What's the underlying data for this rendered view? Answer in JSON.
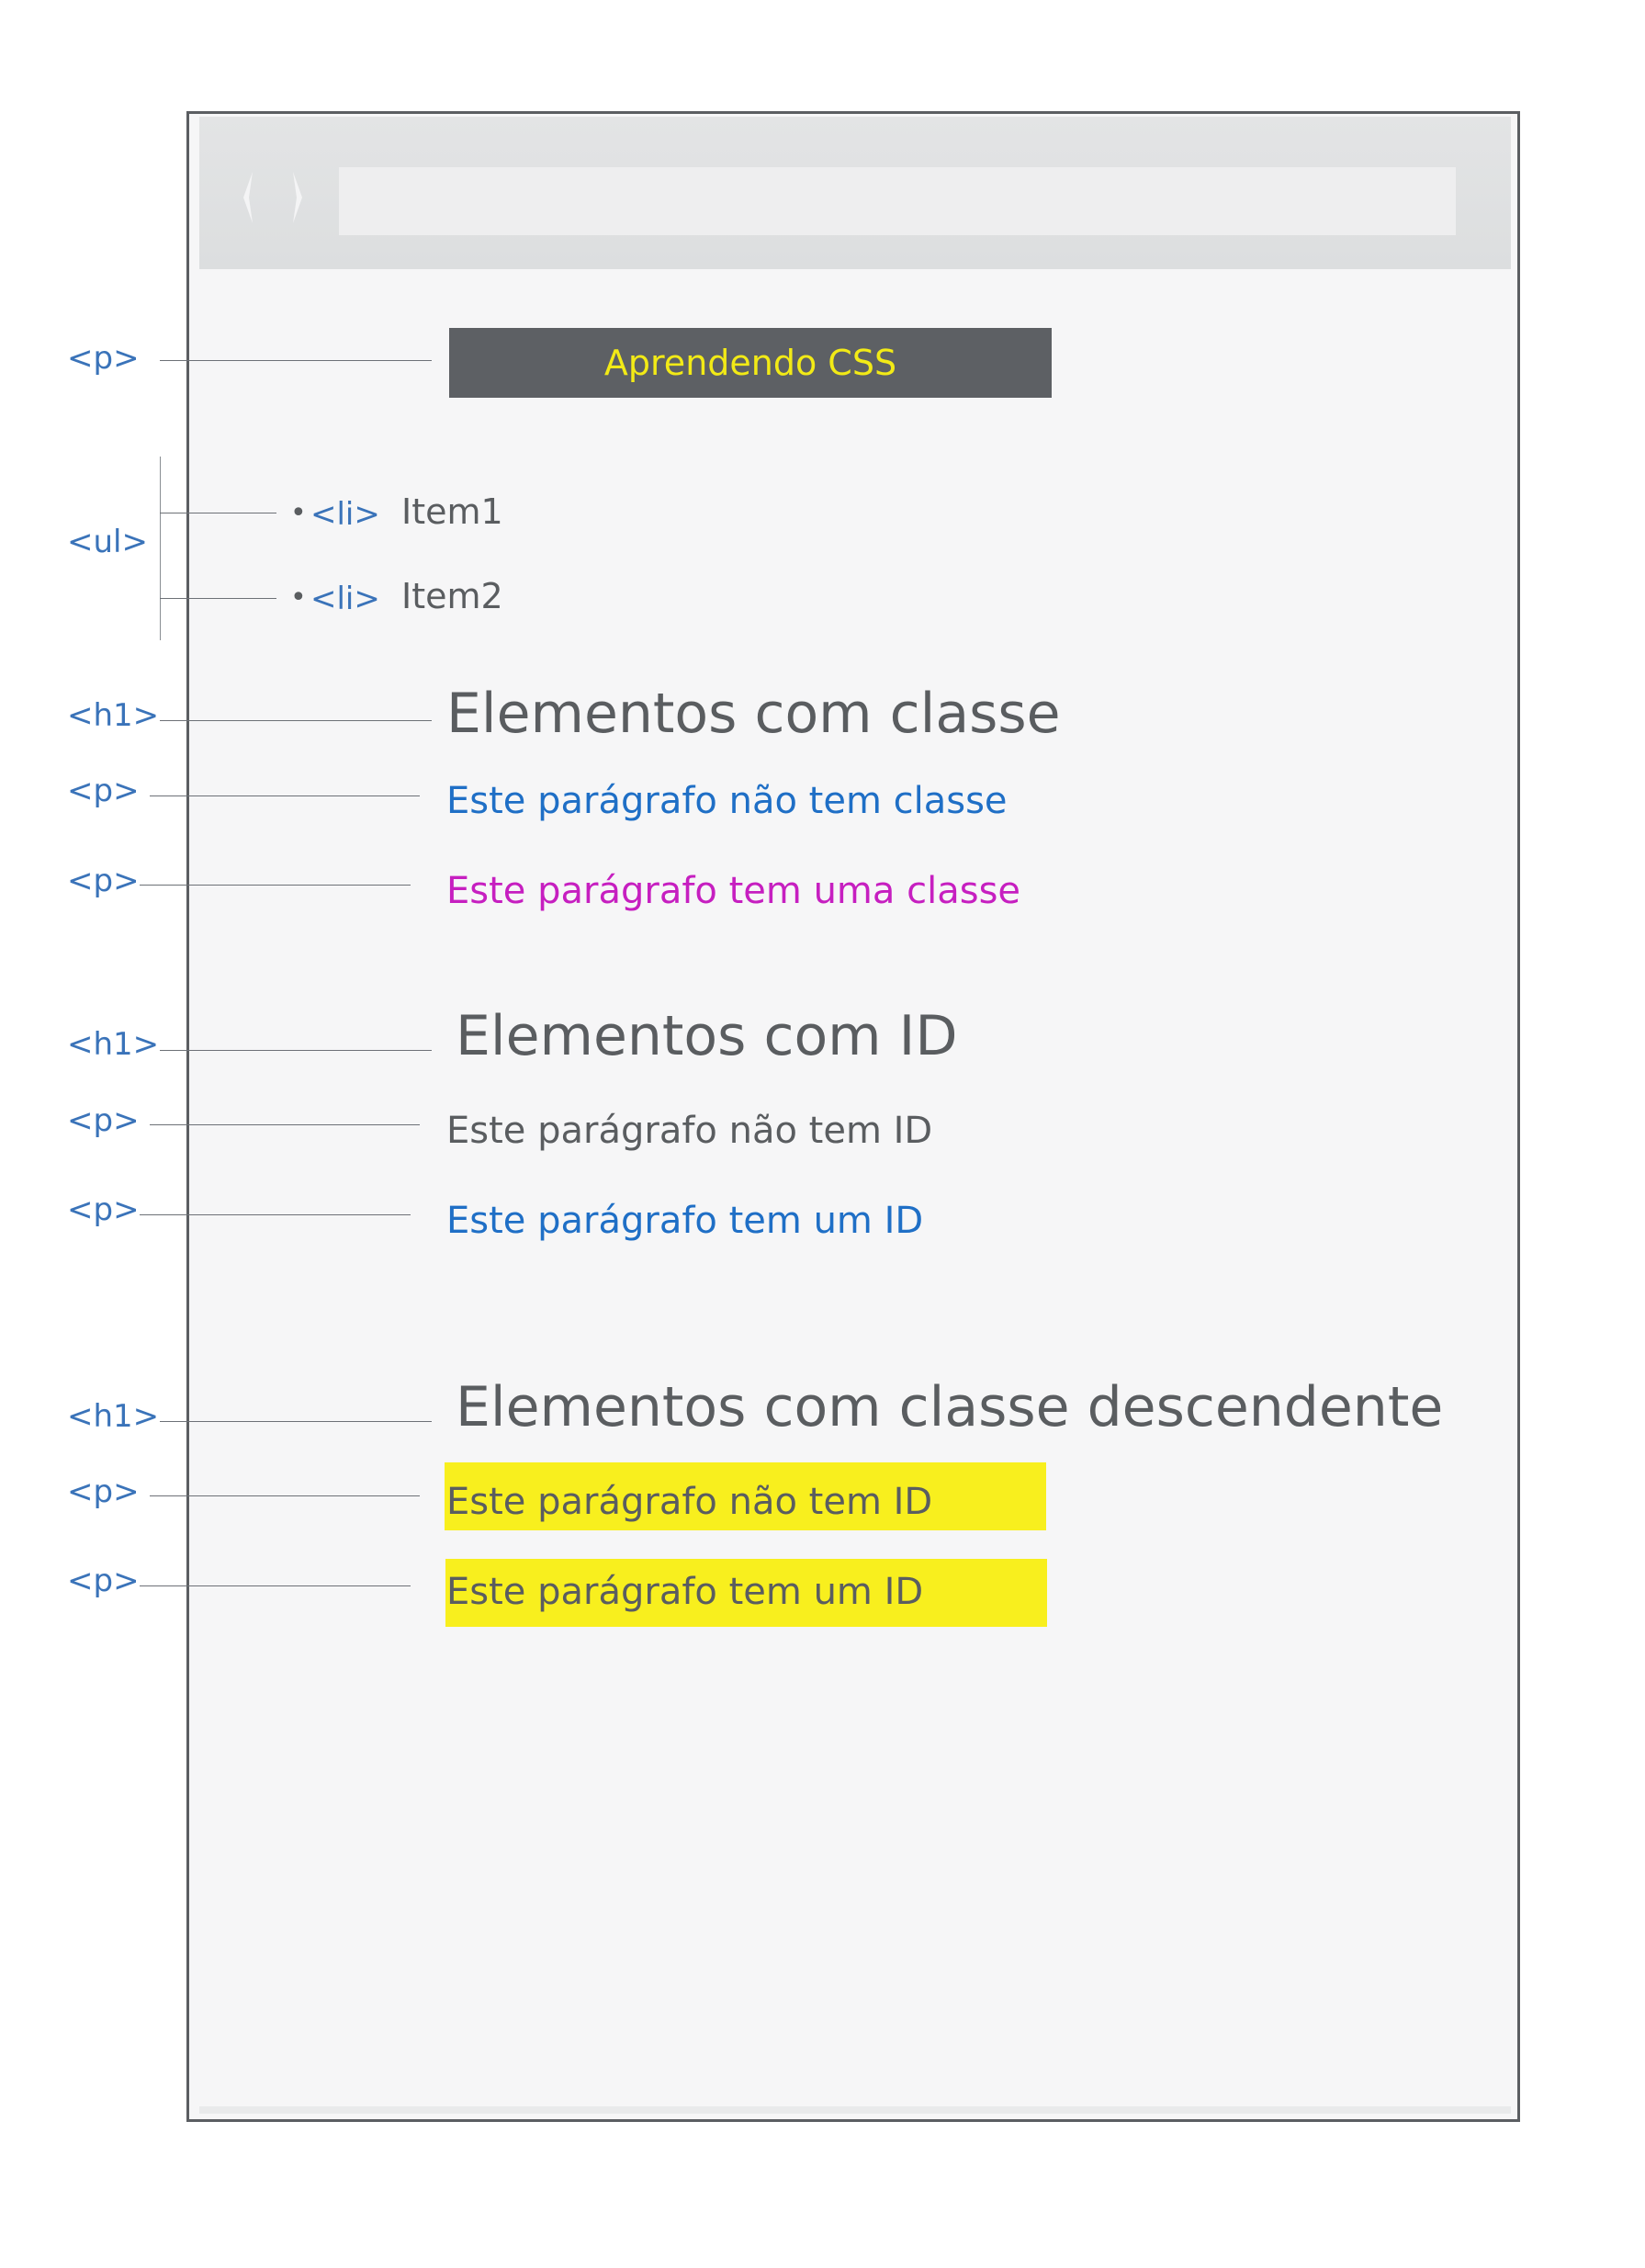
{
  "title_paragraph": {
    "text": "Aprendendo CSS",
    "bg_color": "#5d6064",
    "text_color": "#f2ea16"
  },
  "tags": {
    "p": "<p>",
    "ul": "<ul>",
    "li": "<li>",
    "h1": "<h1>"
  },
  "list": {
    "items": [
      "Item1",
      "Item2"
    ]
  },
  "sections": [
    {
      "heading": "Elementos com classe",
      "paragraphs": [
        {
          "text": "Este parágrafo não tem classe",
          "color": "#1f6fc6"
        },
        {
          "text": "Este parágrafo tem uma classe",
          "color": "#c61fc0"
        }
      ]
    },
    {
      "heading": "Elementos com ID",
      "paragraphs": [
        {
          "text": "Este parágrafo não tem ID",
          "color": "#5a5d60"
        },
        {
          "text": "Este parágrafo tem um ID",
          "color": "#1f6fc6"
        }
      ]
    },
    {
      "heading": "Elementos com classe descendente",
      "paragraphs": [
        {
          "text": "Este parágrafo não tem ID",
          "color": "#5a5d60",
          "highlight": "#f8ef1e"
        },
        {
          "text": "Este parágrafo tem um ID",
          "color": "#5a5d60",
          "highlight": "#f8ef1e"
        }
      ]
    }
  ]
}
